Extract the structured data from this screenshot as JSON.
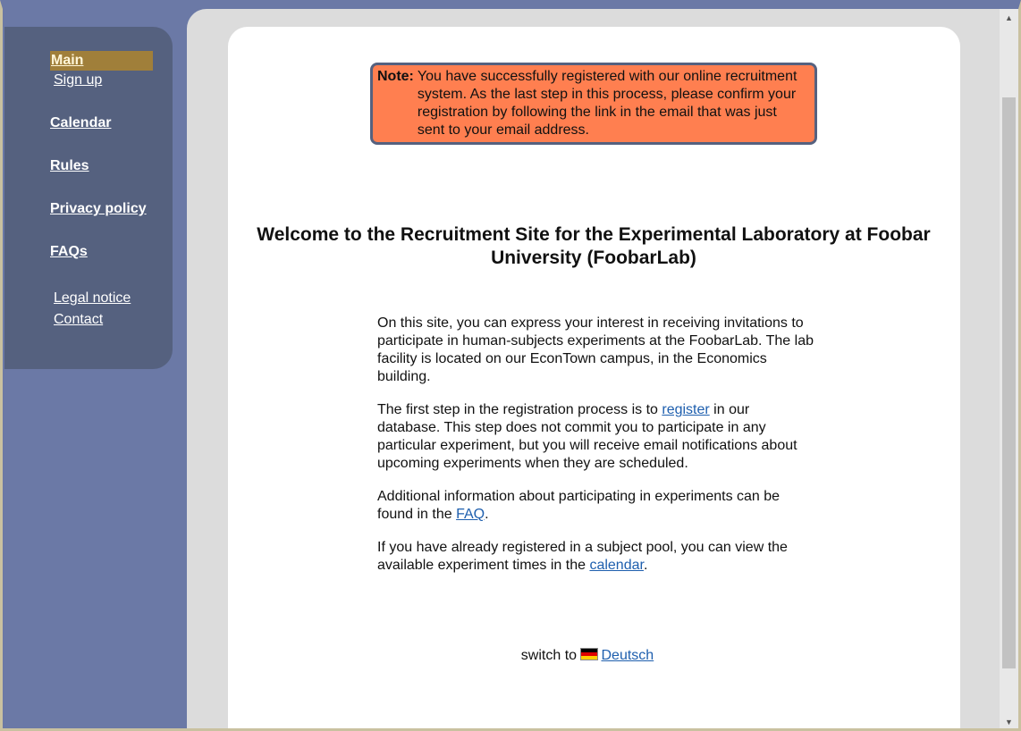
{
  "sidebar": {
    "main": "Main",
    "signup": "Sign up",
    "calendar": "Calendar",
    "rules": "Rules",
    "privacy": "Privacy policy",
    "faqs": "FAQs",
    "legal": "Legal notice",
    "contact": "Contact"
  },
  "note": {
    "label": "Note:",
    "text": "You have successfully registered with our online recruitment system. As the last step in this process, please confirm your registration by following the link in the email that was just sent to your email address."
  },
  "heading": "Welcome to the Recruitment Site for the Experimental Laboratory at Foobar University (FoobarLab)",
  "paragraphs": {
    "p1": "On this site, you can express your interest in receiving invitations to participate in human-subjects experiments at the FoobarLab. The lab facility is located on our EconTown campus, in the Economics building.",
    "p2_before": "The first step in the registration process is to ",
    "p2_link": "register",
    "p2_after": " in our database. This step does not commit you to participate in any particular experiment, but you will receive email notifications about upcoming experiments when they are scheduled.",
    "p3_before": "Additional information about participating in experiments can be found in the ",
    "p3_link": "FAQ",
    "p3_after": ".",
    "p4_before": "If you have already registered in a subject pool, you can view the available experiment times in the ",
    "p4_link": "calendar",
    "p4_after": "."
  },
  "language": {
    "prefix": "switch to ",
    "link": "Deutsch"
  },
  "colors": {
    "sidebar_bg": "#55617f",
    "page_bg": "#6b79a6",
    "active_item": "#a07f3a",
    "note_bg": "#ff7f50",
    "link": "#1e5fae"
  }
}
